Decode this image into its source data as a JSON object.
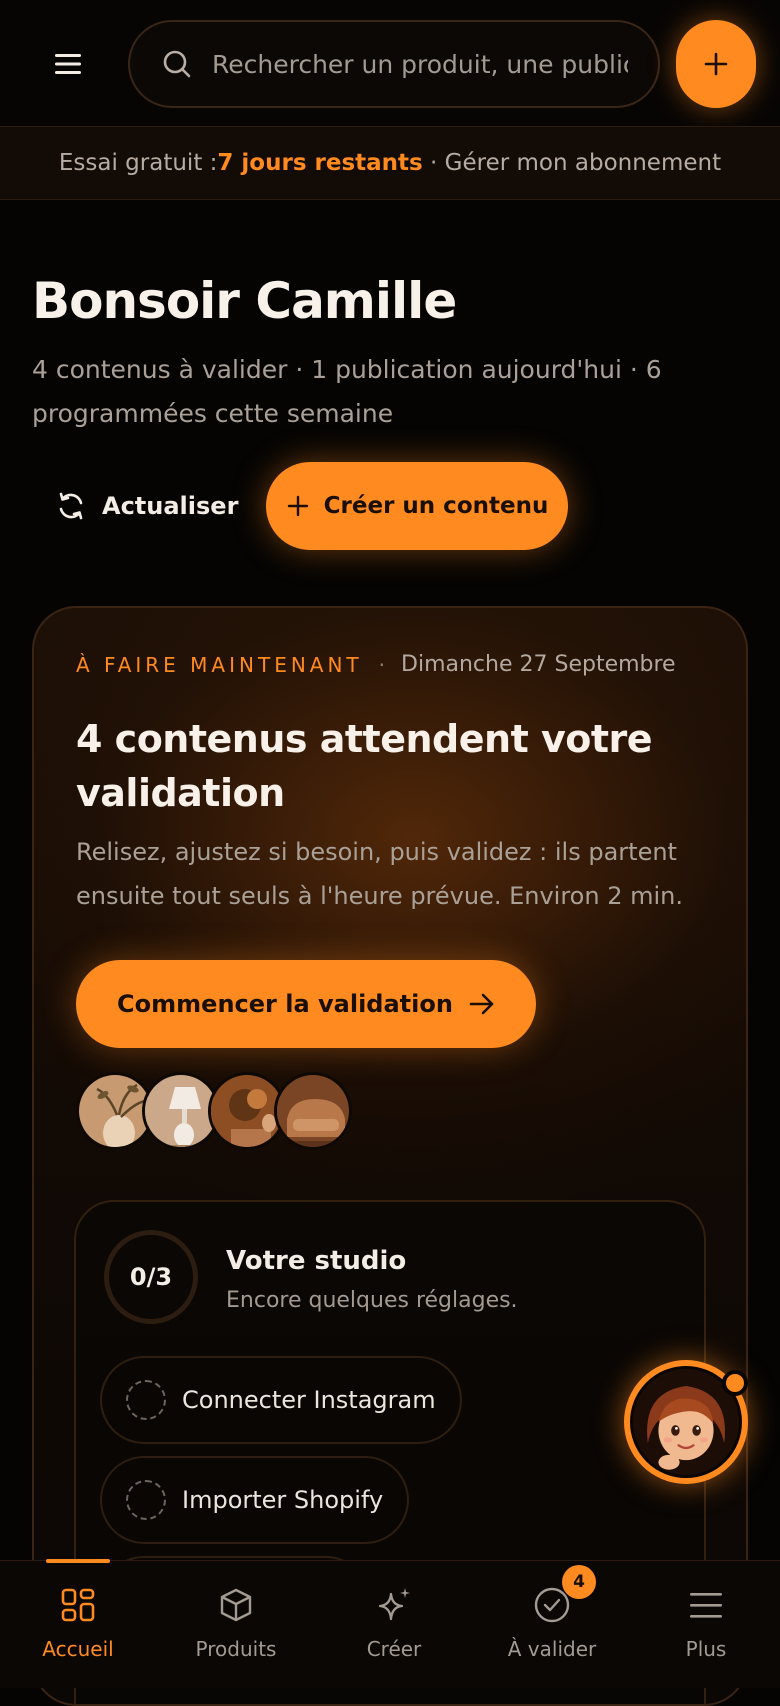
{
  "colors": {
    "accent": "#ff8a1f",
    "background": "#050403",
    "text_primary": "#f4ede6",
    "text_secondary": "#a9a097"
  },
  "header": {
    "menu_icon": "hamburger-menu-icon",
    "search": {
      "icon": "search-icon",
      "placeholder": "Rechercher un produit, une publication…",
      "value": ""
    },
    "add_icon": "plus-icon"
  },
  "trial_banner": {
    "prefix": "Essai gratuit : ",
    "days_remaining": "7 jours restants",
    "separator": " · ",
    "manage_link": "Gérer mon abonnement"
  },
  "greeting": {
    "title": "Bonsoir Camille",
    "summary": "4 contenus à valider · 1 publication aujourd'hui · 6 programmées cette semaine"
  },
  "actions": {
    "refresh_label": "Actualiser",
    "refresh_icon": "refresh-icon",
    "create_label": "Créer un contenu",
    "create_icon": "plus-icon"
  },
  "todo_card": {
    "eyebrow": "À FAIRE MAINTENANT",
    "separator": "·",
    "date": "Dimanche 27 Septembre",
    "title": "4 contenus attendent votre validation",
    "description": "Relisez, ajustez si besoin, puis validez : ils partent ensuite tout seuls à l'heure prévue. Environ 2 min.",
    "cta_label": "Commencer la validation",
    "cta_icon": "arrow-right-icon",
    "thumbnails": [
      {
        "subject": "vase with dried plants",
        "bg": "#c79a72",
        "fg": "#ead2b6"
      },
      {
        "subject": "white table lamp",
        "bg": "#caa889",
        "fg": "#f2ebe3"
      },
      {
        "subject": "plant and lamp on table",
        "bg": "#8e4e24",
        "fg": "#c47a3d"
      },
      {
        "subject": "armchair",
        "bg": "#7a4525",
        "fg": "#b8784a"
      }
    ]
  },
  "studio": {
    "progress": "0/3",
    "progress_value": 0,
    "title": "Votre studio",
    "subtitle": "Encore quelques réglages.",
    "tasks": [
      {
        "label": "Connecter Instagram",
        "done": false
      },
      {
        "label": "Importer Shopify",
        "done": false
      },
      {
        "label": "",
        "done": false
      }
    ]
  },
  "assistant": {
    "icon": "assistant-avatar",
    "status": "online"
  },
  "bottom_nav": {
    "items": [
      {
        "label": "Accueil",
        "icon": "home-grid-icon",
        "active": true
      },
      {
        "label": "Produits",
        "icon": "box-icon",
        "active": false
      },
      {
        "label": "Créer",
        "icon": "sparkles-icon",
        "active": false
      },
      {
        "label": "À valider",
        "icon": "check-circle-icon",
        "active": false,
        "badge": "4"
      },
      {
        "label": "Plus",
        "icon": "menu-lines-icon",
        "active": false
      }
    ]
  }
}
